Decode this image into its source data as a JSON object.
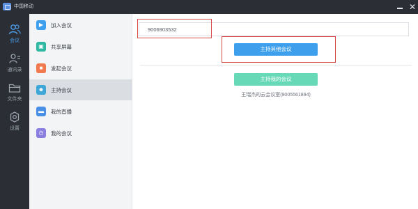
{
  "window": {
    "title": "中国移动",
    "minimize_label": "—",
    "close_label": "✕"
  },
  "leftnav": {
    "items": [
      {
        "label": "会议",
        "icon": "people-icon",
        "active": true
      },
      {
        "label": "通讯录",
        "icon": "contacts-icon",
        "active": false
      },
      {
        "label": "文件夹",
        "icon": "folder-icon",
        "active": false
      },
      {
        "label": "设置",
        "icon": "gear-icon",
        "active": false
      }
    ]
  },
  "submenu": {
    "items": [
      {
        "label": "加入会议",
        "icon": "join-icon",
        "color": "#3ea0ec",
        "active": false
      },
      {
        "label": "共享屏幕",
        "icon": "screen-share-icon",
        "color": "#2fb8a1",
        "active": false
      },
      {
        "label": "发起会议",
        "icon": "video-icon",
        "color": "#f07a4e",
        "active": false
      },
      {
        "label": "主持会议",
        "icon": "host-icon",
        "color": "#3fa6d8",
        "active": true
      },
      {
        "label": "我的直播",
        "icon": "live-icon",
        "color": "#4a8fe6",
        "active": false
      },
      {
        "label": "我的会议",
        "icon": "clock-icon",
        "color": "#8a7ee0",
        "active": false
      }
    ]
  },
  "main": {
    "meeting_id_value": "9006903532",
    "host_others_button": "主持其他会议",
    "host_mine_button": "主持我的会议",
    "room_caption": "王瑞杰的云会议室(9005561894)"
  },
  "colors": {
    "titlebar": "#2b2f35",
    "accent_blue": "#3ea0ec",
    "accent_green": "#68d9b6",
    "highlight_red": "#d84a4a"
  }
}
